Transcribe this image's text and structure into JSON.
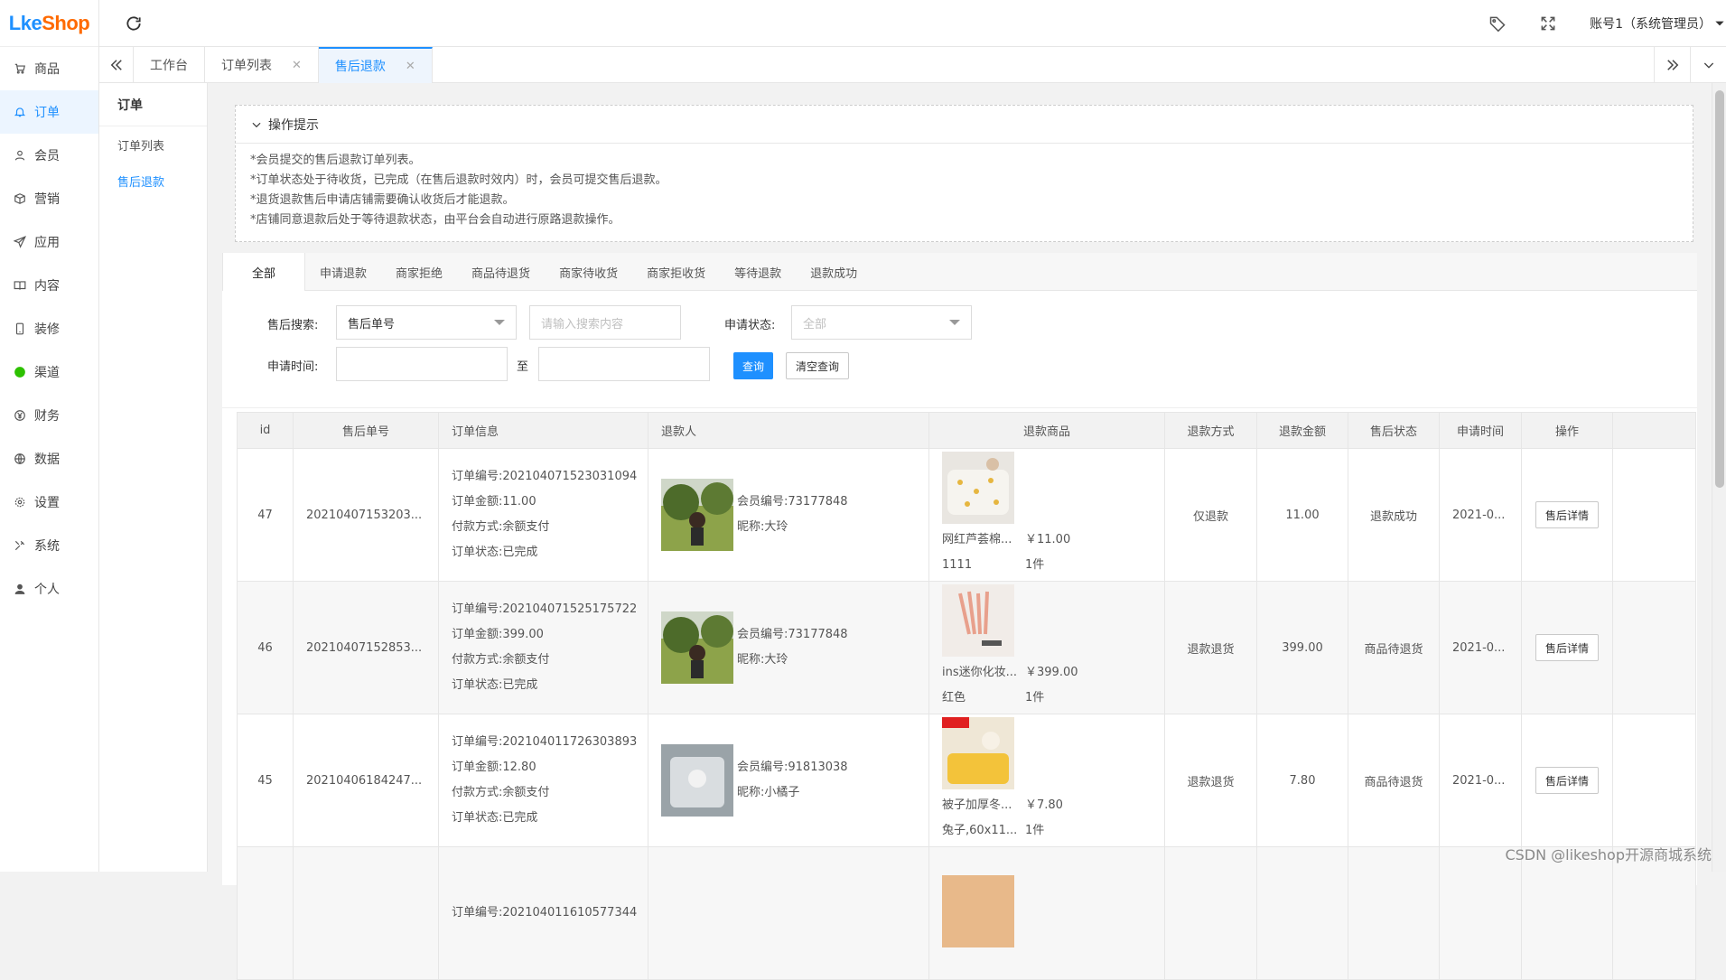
{
  "brand": {
    "logo_main": "Lke",
    "logo_accent": "Shop",
    "logo_text": "LikeShop"
  },
  "sidebar": {
    "items": [
      {
        "label": "商品",
        "icon": "cart-icon"
      },
      {
        "label": "订单",
        "icon": "bell-icon",
        "active": true
      },
      {
        "label": "会员",
        "icon": "user-icon"
      },
      {
        "label": "营销",
        "icon": "box-icon"
      },
      {
        "label": "应用",
        "icon": "send-icon"
      },
      {
        "label": "内容",
        "icon": "book-icon"
      },
      {
        "label": "装修",
        "icon": "phone-icon"
      },
      {
        "label": "渠道",
        "icon": "wechat-icon"
      },
      {
        "label": "财务",
        "icon": "yen-icon"
      },
      {
        "label": "数据",
        "icon": "globe-icon"
      },
      {
        "label": "设置",
        "icon": "gear-icon"
      },
      {
        "label": "系统",
        "icon": "tools-icon"
      },
      {
        "label": "个人",
        "icon": "person-icon"
      }
    ]
  },
  "topbar": {
    "account": "账号1（系统管理员）"
  },
  "tabs": [
    {
      "label": "工作台",
      "closable": false
    },
    {
      "label": "订单列表",
      "closable": true
    },
    {
      "label": "售后退款",
      "closable": true,
      "active": true
    }
  ],
  "subnav": {
    "title": "订单",
    "items": [
      {
        "label": "订单列表"
      },
      {
        "label": "售后退款",
        "active": true
      }
    ]
  },
  "tips": {
    "title": "操作提示",
    "lines": [
      "*会员提交的售后退款订单列表。",
      "*订单状态处于待收货，已完成（在售后退款时效内）时，会员可提交售后退款。",
      "*退货退款售后申请店铺需要确认收货后才能退款。",
      "*店铺同意退款后处于等待退款状态，由平台会自动进行原路退款操作。"
    ]
  },
  "filter_tabs": [
    "全部",
    "申请退款",
    "商家拒绝",
    "商品待退货",
    "商家待收货",
    "商家拒收货",
    "等待退款",
    "退款成功"
  ],
  "search": {
    "label_search": "售后搜索:",
    "search_type": "售后单号",
    "search_placeholder": "请输入搜索内容",
    "label_status": "申请状态:",
    "status_value": "全部",
    "label_time": "申请时间:",
    "to_label": "至",
    "query_button": "查询",
    "clear_button": "清空查询"
  },
  "table": {
    "headers": [
      "id",
      "售后单号",
      "订单信息",
      "退款人",
      "退款商品",
      "退款方式",
      "退款金额",
      "售后状态",
      "申请时间",
      "操作"
    ],
    "rows": [
      {
        "id": "47",
        "sn": "20210407153203...",
        "order": [
          "订单编号:202104071523031094",
          "订单金额:11.00",
          "付款方式:余额支付",
          "订单状态:已完成"
        ],
        "member_no": "会员编号:73177848",
        "nickname": "昵称:大玲",
        "goods_name": "网红芦荟棉...",
        "goods_price": "￥11.00",
        "goods_spec": "1111",
        "goods_qty": "1件",
        "method": "仅退款",
        "amount": "11.00",
        "status": "退款成功",
        "time": "2021-0...",
        "action": "售后详情"
      },
      {
        "id": "46",
        "sn": "20210407152853...",
        "order": [
          "订单编号:202104071525175722",
          "订单金额:399.00",
          "付款方式:余额支付",
          "订单状态:已完成"
        ],
        "member_no": "会员编号:73177848",
        "nickname": "昵称:大玲",
        "goods_name": "ins迷你化妆...",
        "goods_price": "￥399.00",
        "goods_spec": "红色",
        "goods_qty": "1件",
        "method": "退款退货",
        "amount": "399.00",
        "status": "商品待退货",
        "time": "2021-0...",
        "action": "售后详情"
      },
      {
        "id": "45",
        "sn": "20210406184247...",
        "order": [
          "订单编号:202104011726303893",
          "订单金额:12.80",
          "付款方式:余额支付",
          "订单状态:已完成"
        ],
        "member_no": "会员编号:91813038",
        "nickname": "昵称:小橘子",
        "goods_name": "被子加厚冬...",
        "goods_price": "￥7.80",
        "goods_spec": "兔子,60x11...",
        "goods_qty": "1件",
        "method": "退款退货",
        "amount": "7.80",
        "status": "商品待退货",
        "time": "2021-0...",
        "action": "售后详情"
      },
      {
        "id": "",
        "sn": "",
        "order": [
          "订单编号:202104011610577344",
          "",
          "",
          ""
        ],
        "member_no": "",
        "nickname": "",
        "goods_name": "",
        "goods_price": "",
        "goods_spec": "",
        "goods_qty": "",
        "method": "",
        "amount": "",
        "status": "",
        "time": "",
        "action": ""
      }
    ]
  },
  "watermark": "CSDN @likeshop开源商城系统"
}
